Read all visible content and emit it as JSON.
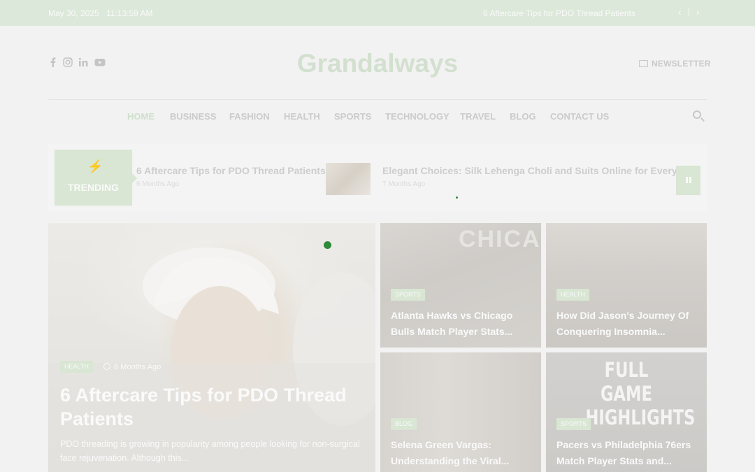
{
  "topbar": {
    "date": "May 30, 2025",
    "time": "11:13:59 AM",
    "ticker": "6 Aftercare Tips for PDO Thread Patients",
    "prev": "‹",
    "next": "›"
  },
  "header": {
    "logo": "Grandalways",
    "newsletter": "NEWSLETTER",
    "social": [
      "facebook-icon",
      "instagram-icon",
      "linkedin-icon",
      "youtube-icon"
    ]
  },
  "nav": {
    "items": [
      "HOME",
      "BUSINESS",
      "FASHION",
      "HEALTH",
      "SPORTS",
      "TECHNOLOGY",
      "TRAVEL",
      "BLOG",
      "CONTACT US"
    ],
    "active": "HOME"
  },
  "trending": {
    "label": "TRENDING",
    "items": [
      {
        "title": "6 Aftercare Tips for PDO Thread Patients",
        "time": "6 Months Ago"
      },
      {
        "title": "Elegant Choices: Silk Lehenga Choli and Suits Online for Every Occasion",
        "time": "7 Months Ago"
      }
    ]
  },
  "featured": {
    "main": {
      "category": "HEALTH",
      "time": "6 Months Ago",
      "title": "6 Aftercare Tips for PDO Thread Patients",
      "excerpt": "PDO threading is growing in popularity among people looking for non-surgical face rejuvenation. Although this..."
    },
    "cards": [
      {
        "category": "SPORTS",
        "title": "Atlanta Hawks vs Chicago Bulls Match Player Stats..."
      },
      {
        "category": "HEALTH",
        "title": "How Did Jason's Journey Of Conquering Insomnia..."
      },
      {
        "category": "BLOG",
        "title": "Selena Green Vargas: Understanding the Viral..."
      },
      {
        "category": "SPORTS",
        "title": "Pacers vs Philadelphia 76ers Match Player Stats and..."
      }
    ],
    "card_image_text": {
      "jersey": "CHICA",
      "highlights": "FULL GAME HIGHLIGHTS"
    }
  },
  "colors": {
    "accent": "#d8e6d3",
    "dot": "#2e8b3a"
  }
}
